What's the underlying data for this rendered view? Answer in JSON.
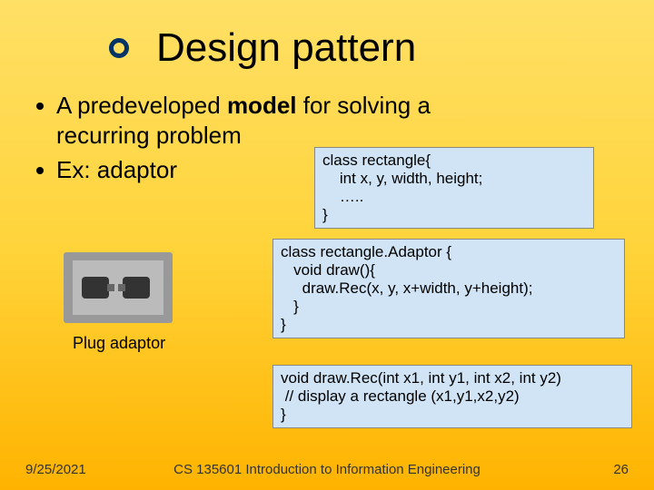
{
  "title": "Design pattern",
  "bullets": {
    "b1_part1": "A predeveloped ",
    "b1_model": "model",
    "b1_part2": " for solving a",
    "b1_line2": "recurring problem",
    "b2": "Ex: adaptor"
  },
  "code": {
    "box1": "class rectangle{\n    int x, y, width, height;\n    …..\n}",
    "box2": "class rectangle.Adaptor {\n   void draw(){\n     draw.Rec(x, y, x+width, y+height);\n   }\n}",
    "box3": "void draw.Rec(int x1, int y1, int x2, int y2)\n // display a rectangle (x1,y1,x2,y2)\n}"
  },
  "plug_caption": "Plug adaptor",
  "footer": {
    "date": "9/25/2021",
    "course": "CS 135601 Introduction to Information Engineering",
    "page": "26"
  }
}
